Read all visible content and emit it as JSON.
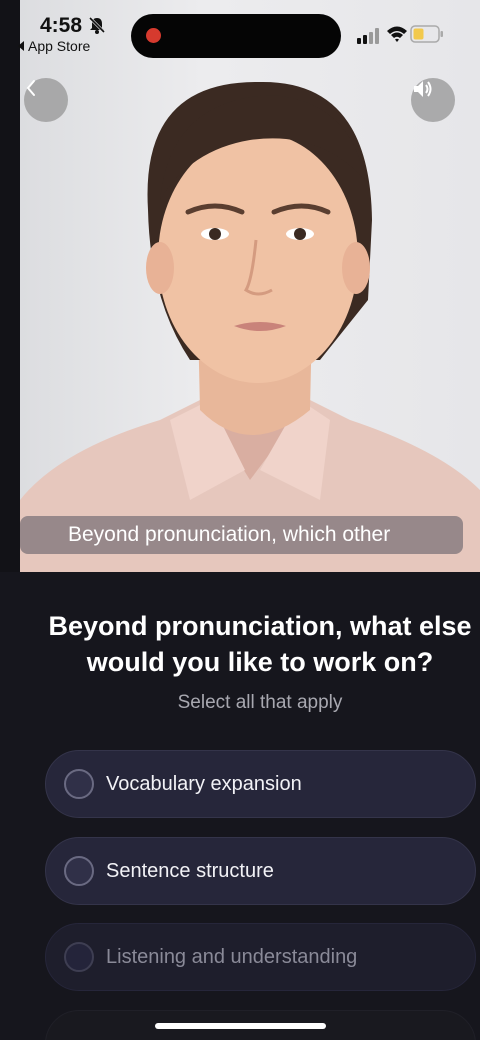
{
  "status_bar": {
    "time": "4:58",
    "back_app": "App Store",
    "icons": [
      "bell-slash-icon",
      "signal-icon",
      "wifi-icon",
      "battery-icon"
    ],
    "recording": true
  },
  "video": {
    "caption": "Beyond pronunciation, which other",
    "back_icon": "chevron-left-icon",
    "sound_icon": "speaker-icon"
  },
  "question": {
    "title_line1": "Beyond pronunciation, what else",
    "title_line2": "would you like to work on?",
    "subtitle": "Select all that apply"
  },
  "options": [
    {
      "label": "Vocabulary expansion",
      "selected": false
    },
    {
      "label": "Sentence structure",
      "selected": false
    },
    {
      "label": "Listening and understanding",
      "selected": false
    },
    {
      "label": "",
      "selected": false
    }
  ],
  "colors": {
    "background": "#16161d",
    "option_bg": "#26263a",
    "recording_dot": "#d63a2e",
    "battery_level": "#f2c94c"
  }
}
